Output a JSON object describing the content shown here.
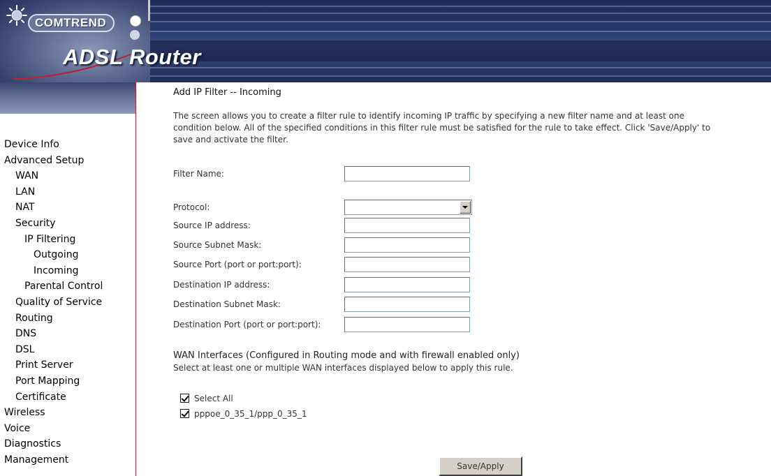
{
  "header": {
    "brand": "COMTREND",
    "title": "ADSL Router"
  },
  "sidebar": {
    "items": [
      {
        "label": "Device Info",
        "level": 0
      },
      {
        "label": "Advanced Setup",
        "level": 0
      },
      {
        "label": "WAN",
        "level": 1
      },
      {
        "label": "LAN",
        "level": 1
      },
      {
        "label": "NAT",
        "level": 1
      },
      {
        "label": "Security",
        "level": 1
      },
      {
        "label": "IP Filtering",
        "level": 2
      },
      {
        "label": "Outgoing",
        "level": 3
      },
      {
        "label": "Incoming",
        "level": 3
      },
      {
        "label": "Parental Control",
        "level": 2
      },
      {
        "label": "Quality of Service",
        "level": 1
      },
      {
        "label": "Routing",
        "level": 1
      },
      {
        "label": "DNS",
        "level": 1
      },
      {
        "label": "DSL",
        "level": 1
      },
      {
        "label": "Print Server",
        "level": 1
      },
      {
        "label": "Port Mapping",
        "level": 1
      },
      {
        "label": "Certificate",
        "level": 1
      },
      {
        "label": "Wireless",
        "level": 0
      },
      {
        "label": "Voice",
        "level": 0
      },
      {
        "label": "Diagnostics",
        "level": 0
      },
      {
        "label": "Management",
        "level": 0
      }
    ]
  },
  "main": {
    "title": "Add IP Filter -- Incoming",
    "description": [
      "The screen allows you to create a filter rule to identify incoming IP traffic by specifying a new filter name and at least one",
      "condition below. All of the specified conditions in this filter rule must be satisfied for the rule to take effect. Click 'Save/Apply' to",
      "save and activate the filter."
    ],
    "form": {
      "filter_name": {
        "label": "Filter Name:",
        "value": ""
      },
      "protocol": {
        "label": "Protocol:",
        "value": ""
      },
      "source_ip": {
        "label": "Source IP address:",
        "value": ""
      },
      "source_mask": {
        "label": "Source Subnet Mask:",
        "value": ""
      },
      "source_port": {
        "label": "Source Port (port or port:port):",
        "value": ""
      },
      "dest_ip": {
        "label": "Destination IP address:",
        "value": ""
      },
      "dest_mask": {
        "label": "Destination Subnet Mask:",
        "value": ""
      },
      "dest_port": {
        "label": "Destination Port (port or port:port):",
        "value": ""
      }
    },
    "wan": {
      "heading": "WAN Interfaces (Configured in Routing mode and with firewall enabled only)",
      "description": "Select at least one or multiple WAN interfaces displayed below to apply this rule.",
      "select_all": {
        "label": "Select All",
        "checked": true
      },
      "interfaces": [
        {
          "label": "pppoe_0_35_1/ppp_0_35_1",
          "checked": true
        }
      ]
    },
    "save_label": "Save/Apply"
  }
}
